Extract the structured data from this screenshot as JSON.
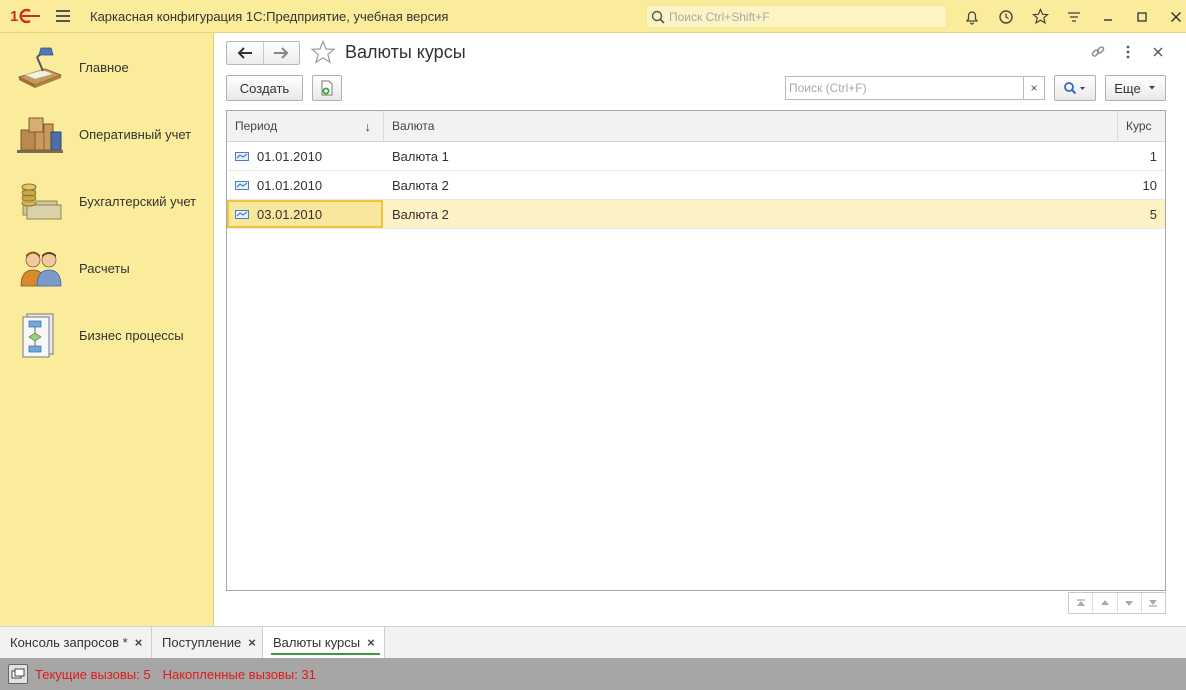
{
  "app": {
    "title": "Каркасная конфигурация 1С:Предприятие, учебная версия",
    "search_placeholder": "Поиск Ctrl+Shift+F"
  },
  "sidebar": {
    "items": [
      {
        "label": "Главное",
        "icon": "desk-lamp-icon"
      },
      {
        "label": "Оперативный учет",
        "icon": "boxes-icon"
      },
      {
        "label": "Бухгалтерский учет",
        "icon": "coins-icon"
      },
      {
        "label": "Расчеты",
        "icon": "people-icon"
      },
      {
        "label": "Бизнес процессы",
        "icon": "flowchart-icon"
      }
    ]
  },
  "page": {
    "title": "Валюты курсы",
    "create_label": "Создать",
    "search_placeholder": "Поиск (Ctrl+F)",
    "clear_label": "×",
    "more_label": "Еще"
  },
  "table": {
    "columns": [
      "Период",
      "Валюта",
      "Курс"
    ],
    "sort_indicator": "↓",
    "rows": [
      {
        "period": "01.01.2010",
        "currency": "Валюта 1",
        "rate": "1"
      },
      {
        "period": "01.01.2010",
        "currency": "Валюта 2",
        "rate": "10"
      },
      {
        "period": "03.01.2010",
        "currency": "Валюта 2",
        "rate": "5"
      }
    ],
    "selected_row": 2
  },
  "tabs": [
    {
      "label": "Консоль запросов *",
      "close": "×"
    },
    {
      "label": "Поступление",
      "close": "×"
    },
    {
      "label": "Валюты курсы",
      "close": "×",
      "active": true
    }
  ],
  "status": {
    "current_calls": "Текущие вызовы: 5",
    "accumulated_calls": "Накопленные вызовы: 31"
  },
  "colors": {
    "accent_yellow": "#fbec9c",
    "selection": "#f9e79e",
    "status_red": "#e01b1b",
    "tab_underline": "#3c9c3c"
  }
}
